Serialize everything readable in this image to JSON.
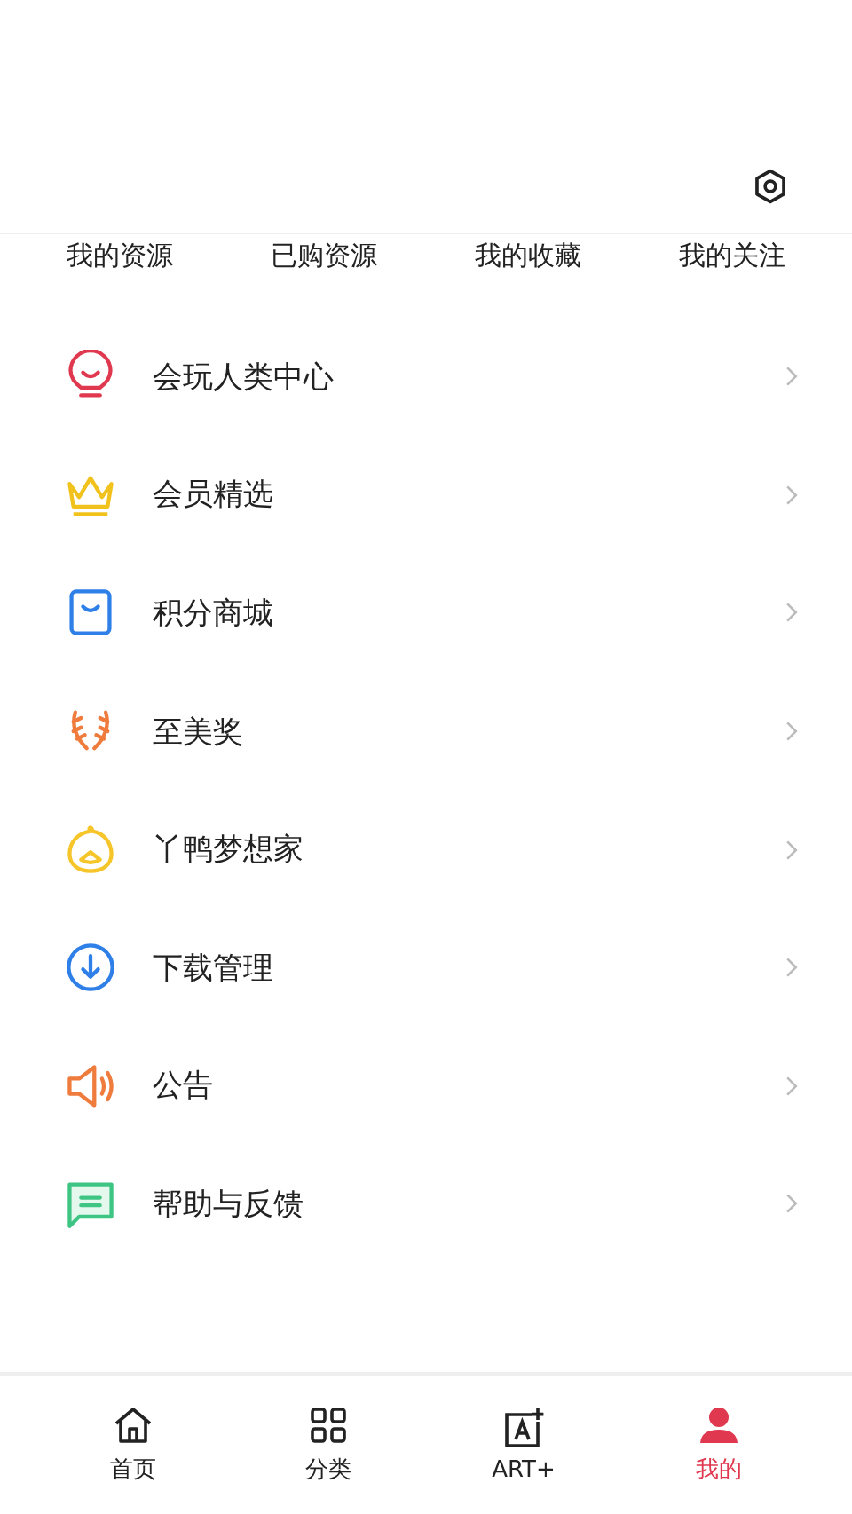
{
  "tabs": [
    {
      "label": "我的资源"
    },
    {
      "label": "已购资源"
    },
    {
      "label": "我的收藏"
    },
    {
      "label": "我的关注"
    }
  ],
  "menu": [
    {
      "kind": "bulb",
      "label": "会玩人类中心"
    },
    {
      "kind": "crown",
      "label": "会员精选"
    },
    {
      "kind": "bag",
      "label": "积分商城"
    },
    {
      "kind": "laurel",
      "label": "至美奖"
    },
    {
      "kind": "duck",
      "label": "丫鸭梦想家"
    },
    {
      "kind": "download",
      "label": "下载管理"
    },
    {
      "kind": "speaker",
      "label": "公告"
    },
    {
      "kind": "chat",
      "label": "帮助与反馈"
    }
  ],
  "nav": [
    {
      "kind": "home",
      "label": "首页",
      "selected": false
    },
    {
      "kind": "grid",
      "label": "分类",
      "selected": false
    },
    {
      "kind": "art",
      "label": "ART+",
      "selected": false
    },
    {
      "kind": "person",
      "label": "我的",
      "selected": true
    }
  ]
}
